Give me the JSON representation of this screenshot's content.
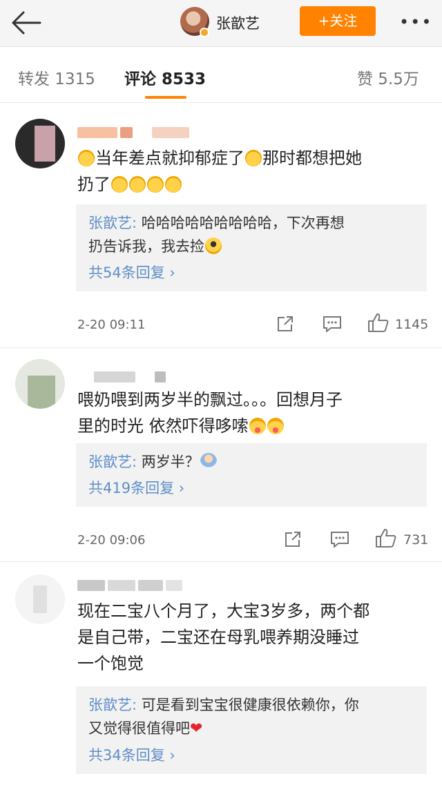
{
  "header": {
    "username": "张歆艺",
    "follow_label": "+关注",
    "back_icon": "back-arrow-icon",
    "more_icon": "more-icon",
    "more_glyph": "•••"
  },
  "tabs": [
    {
      "label": "转发 1315"
    },
    {
      "label": "评论 8533"
    },
    {
      "label": "赞 5.5万"
    }
  ],
  "comments": [
    {
      "text_a": "当年差点就抑郁症了",
      "text_b": "那时都想把她",
      "text_c": "扔了",
      "reply_author": "张歆艺: ",
      "reply_text_a": "哈哈哈哈哈哈哈哈哈，下次再想",
      "reply_text_b": "扔告诉我，我去捡",
      "reply_count": "共54条回复 ›",
      "time": "2-20 09:11",
      "likes": "1145"
    },
    {
      "text_a": "喂奶喂到两岁半的飘过。。。回想月子",
      "text_b": "里的时光 依然吓得哆嗦",
      "reply_author": "张歆艺: ",
      "reply_text_a": "两岁半？",
      "reply_count": "共419条回复 ›",
      "time": "2-20 09:06",
      "likes": "731"
    },
    {
      "text_a": "现在二宝八个月了，大宝3岁多，两个都",
      "text_b": "是自己带，二宝还在母乳喂养期没睡过",
      "text_c": "一个饱觉",
      "reply_author": "张歆艺: ",
      "reply_text_a": "可是看到宝宝很健康很依赖你，你",
      "reply_text_b": "又觉得很值得吧",
      "reply_count": "共34条回复 ›"
    }
  ],
  "colors": {
    "accent": "#ff8200",
    "link": "#5f8ec8"
  }
}
